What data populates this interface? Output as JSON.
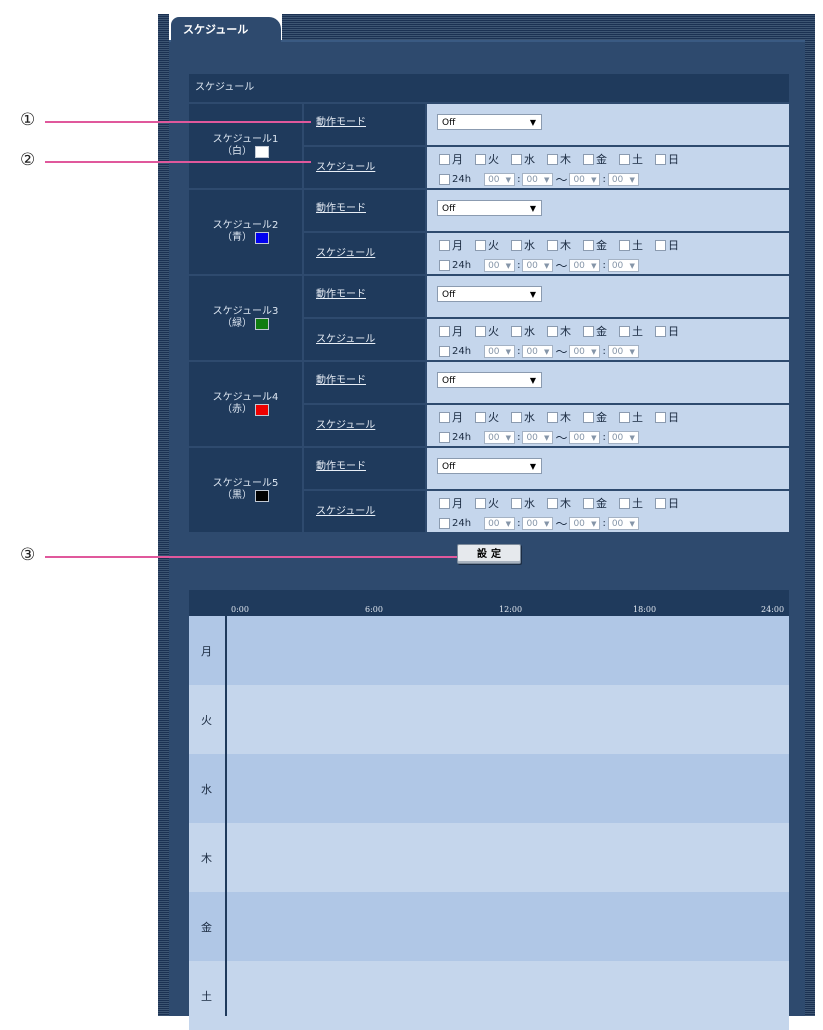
{
  "tab": {
    "label": "スケジュール"
  },
  "section": {
    "title": "スケジュール"
  },
  "labels": {
    "mode": "動作モード",
    "schedule": "スケジュール"
  },
  "days": [
    "月",
    "火",
    "水",
    "木",
    "金",
    "土",
    "日"
  ],
  "time": {
    "h24_label": "24h",
    "start_hour": "00",
    "start_min": "00",
    "end_hour": "00",
    "end_min": "00",
    "tilde": "～",
    "colon": ":"
  },
  "schedules": [
    {
      "name": "スケジュール1",
      "color_label": "（白）",
      "color": "#ffffff",
      "mode": "Off"
    },
    {
      "name": "スケジュール2",
      "color_label": "（青）",
      "color": "#0000ee",
      "mode": "Off"
    },
    {
      "name": "スケジュール3",
      "color_label": "（緑）",
      "color": "#107c10",
      "mode": "Off"
    },
    {
      "name": "スケジュール4",
      "color_label": "（赤）",
      "color": "#ee0000",
      "mode": "Off"
    },
    {
      "name": "スケジュール5",
      "color_label": "（黒）",
      "color": "#000000",
      "mode": "Off"
    }
  ],
  "set_button": {
    "label": "設定"
  },
  "timeline": {
    "ticks": [
      "0:00",
      "6:00",
      "12:00",
      "18:00",
      "24:00"
    ],
    "rows": [
      "月",
      "火",
      "水",
      "木",
      "金",
      "土"
    ],
    "row_colors": [
      "#b0c7e6",
      "#c5d6ec"
    ]
  },
  "callouts": [
    "①",
    "②",
    "③"
  ]
}
